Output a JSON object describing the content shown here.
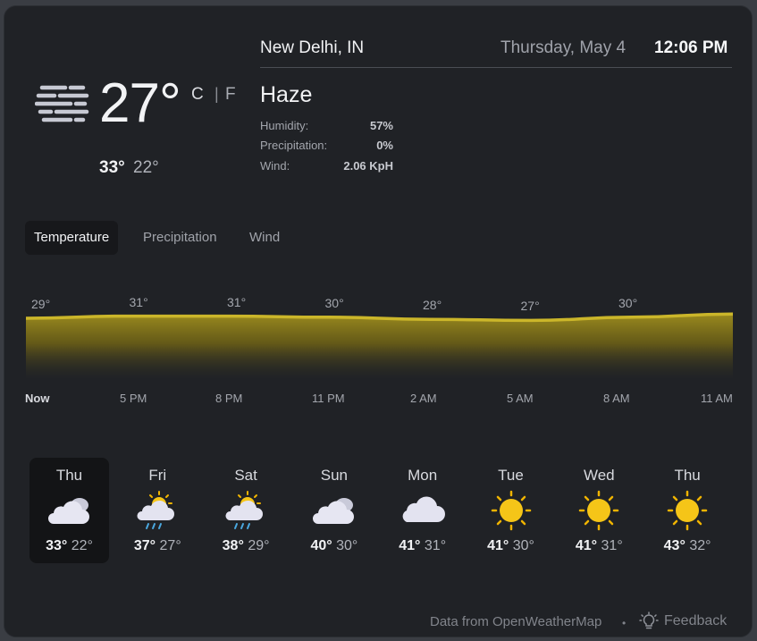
{
  "current": {
    "condition_icon": "haze-icon",
    "temperature": "27°",
    "unit_c": "C",
    "unit_sep": "|",
    "unit_f": "F",
    "high": "33°",
    "low": "22°"
  },
  "header": {
    "location": "New Delhi, IN",
    "date": "Thursday, May 4",
    "time": "12:06 PM"
  },
  "conditions": {
    "summary": "Haze",
    "details": [
      {
        "label": "Humidity:",
        "value": "57%"
      },
      {
        "label": "Precipitation:",
        "value": "0%"
      },
      {
        "label": "Wind:",
        "value": "2.06 KpH"
      }
    ]
  },
  "tabs": [
    {
      "label": "Temperature",
      "active": true
    },
    {
      "label": "Precipitation",
      "active": false
    },
    {
      "label": "Wind",
      "active": false
    }
  ],
  "chart_data": {
    "type": "area",
    "x": [
      "Now",
      "5 PM",
      "8 PM",
      "11 PM",
      "2 AM",
      "5 AM",
      "8 AM",
      "11 AM"
    ],
    "point_labels": [
      "29°",
      "31°",
      "31°",
      "30°",
      "28°",
      "27°",
      "30°"
    ],
    "values": [
      29,
      31,
      31,
      30,
      28,
      27,
      30,
      33
    ],
    "color": "#c9b428"
  },
  "forecast": [
    {
      "day": "Thu",
      "icon": "cloudy-icon",
      "hi": "33°",
      "lo": "22°",
      "selected": true
    },
    {
      "day": "Fri",
      "icon": "sun-rain-cloud-icon",
      "hi": "37°",
      "lo": "27°",
      "selected": false
    },
    {
      "day": "Sat",
      "icon": "sun-rain-cloud-icon",
      "hi": "38°",
      "lo": "29°",
      "selected": false
    },
    {
      "day": "Sun",
      "icon": "cloudy-icon",
      "hi": "40°",
      "lo": "30°",
      "selected": false
    },
    {
      "day": "Mon",
      "icon": "cloud-icon",
      "hi": "41°",
      "lo": "31°",
      "selected": false
    },
    {
      "day": "Tue",
      "icon": "sun-icon",
      "hi": "41°",
      "lo": "30°",
      "selected": false
    },
    {
      "day": "Wed",
      "icon": "sun-icon",
      "hi": "41°",
      "lo": "31°",
      "selected": false
    },
    {
      "day": "Thu",
      "icon": "sun-icon",
      "hi": "43°",
      "lo": "32°",
      "selected": false
    }
  ],
  "footer": {
    "source": "Data from OpenWeatherMap",
    "separator": "•",
    "feedback_icon": "lightbulb-icon",
    "feedback_label": "Feedback"
  }
}
